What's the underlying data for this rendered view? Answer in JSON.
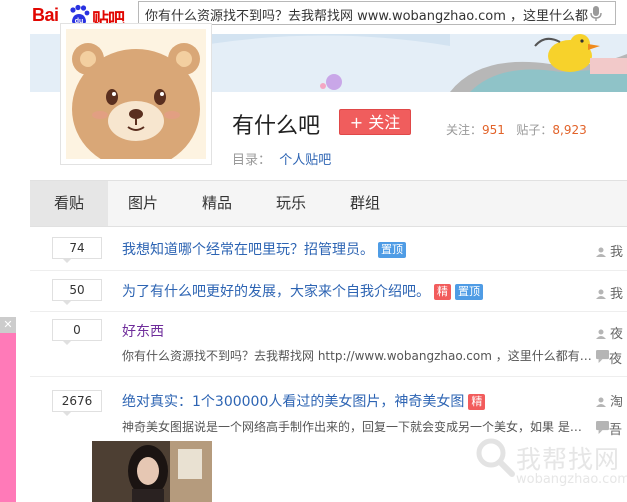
{
  "header": {
    "logo_text_bai": "Bai",
    "logo_text_du": "du",
    "logo_text_tieba": "贴吧",
    "search_value": "你有什么资源找不到吗？去我帮找网 www.wobangzhao.com ，这里什么都",
    "colors": {
      "brand_red": "#e10601",
      "link_blue": "#2d64b3",
      "accent_orange": "#e2632a"
    }
  },
  "forum": {
    "name": "有什么吧",
    "follow_label": "+ 关注",
    "follow_count_label": "关注：",
    "follow_count": "951",
    "post_count_label": "贴子：",
    "post_count": "8,923",
    "catalog_label": "目录：",
    "catalog_value": "个人贴吧"
  },
  "tabs": [
    "看贴",
    "图片",
    "精品",
    "玩乐",
    "群组"
  ],
  "threads": [
    {
      "replies": "74",
      "title": "我想知道哪个经常在吧里玩？招管理员。",
      "tags": [
        "置顶"
      ],
      "author": "我"
    },
    {
      "replies": "50",
      "title": "为了有什么吧更好的发展，大家来个自我介绍吧。",
      "tags": [
        "精",
        "置顶"
      ],
      "author": "我"
    },
    {
      "replies": "0",
      "title": "好东西",
      "abstract": "你有什么资源找不到吗？去我帮找网 http://www.wobangzhao.com ，这里什么都有…",
      "author": "夜",
      "last": "夜"
    },
    {
      "replies": "2676",
      "title": "绝对真实：1个300000人看过的美女图片，神奇美女图",
      "tags": [
        "精"
      ],
      "abstract": "神奇美女图据说是一个网络高手制作出来的，回复一下就会变成另一个美女，如果 是…",
      "author": "淘",
      "last": "吾"
    }
  ],
  "left_ad": {
    "close_label": "✕"
  },
  "watermark": {
    "text": "我帮找网",
    "url": "wobangzhao.com"
  }
}
